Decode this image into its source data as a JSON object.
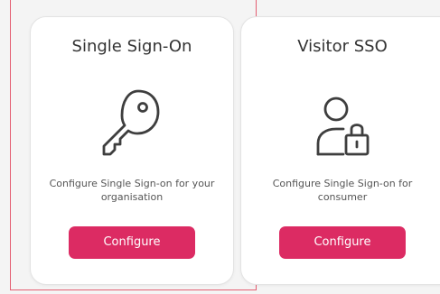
{
  "cards": [
    {
      "title": "Single Sign-On",
      "icon": "key-icon",
      "description": "Configure Single Sign-on for your organisation",
      "button_label": "Configure"
    },
    {
      "title": "Visitor SSO",
      "icon": "user-lock-icon",
      "description": "Configure Single Sign-on for consumer",
      "button_label": "Configure"
    }
  ],
  "colors": {
    "button": "#dc2b63",
    "selection": "#e45f72",
    "text": "#333333",
    "muted_text": "#555555",
    "card_background": "#ffffff",
    "page_background": "#f4f4f4"
  }
}
